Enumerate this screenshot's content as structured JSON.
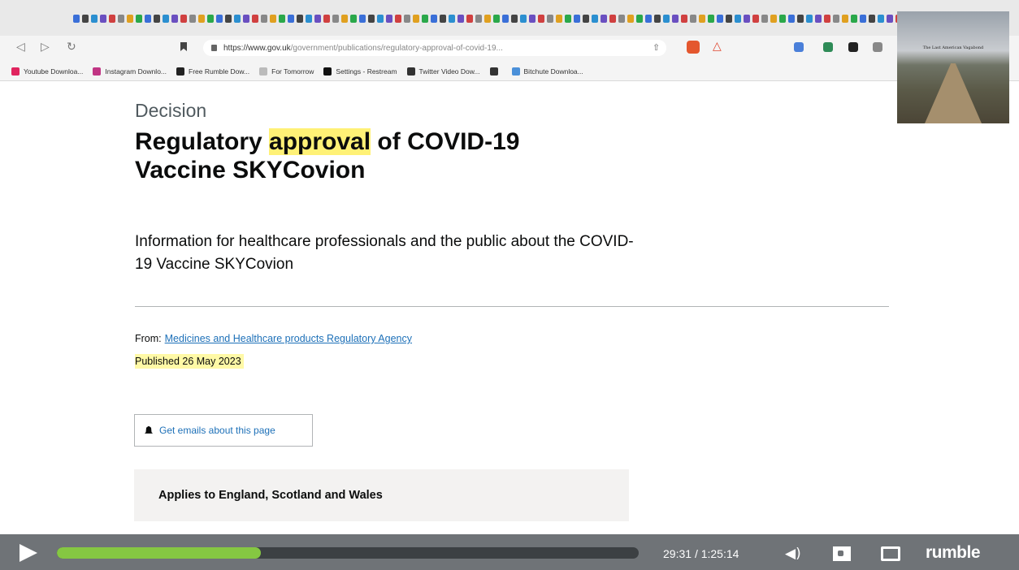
{
  "browser": {
    "url_host": "https://www.gov.uk",
    "url_path": "/government/publications/regulatory-approval-of-covid-19...",
    "bookmarks": [
      {
        "label": "Youtube Downloa...",
        "icon": "youtube-icon",
        "color": "#e0245e"
      },
      {
        "label": "Instagram Downlo...",
        "icon": "instagram-icon",
        "color": "#c13584"
      },
      {
        "label": "Free Rumble Dow...",
        "icon": "cloud-icon",
        "color": "#222222"
      },
      {
        "label": "For Tomorrow",
        "icon": "folder-icon",
        "color": "#bbbbbb"
      },
      {
        "label": "Settings - Restream",
        "icon": "restream-icon",
        "color": "#111111"
      },
      {
        "label": "Twitter Video Dow...",
        "icon": "globe-icon",
        "color": "#333333"
      },
      {
        "label": "",
        "icon": "globe-icon",
        "color": "#333333"
      },
      {
        "label": "Bitchute Downloa...",
        "icon": "bitchute-icon",
        "color": "#4a90d9"
      }
    ]
  },
  "overlay": {
    "caption": "The Last American Vagabond"
  },
  "page": {
    "kind": "Decision",
    "title_pre": "Regulatory ",
    "title_highlight": "approval",
    "title_post": " of COVID-19 Vaccine SKYCovion",
    "summary": "Information for healthcare professionals and the public about the COVID-19 Vaccine SKYCovion",
    "from_label": "From:",
    "from_org": "Medicines and Healthcare products Regulatory Agency",
    "published_label": "Published",
    "published_date": "26 May 2023",
    "email_button": "Get emails about this page",
    "applies_to": "Applies to England, Scotland and Wales"
  },
  "player": {
    "current_time": "29:31",
    "separator": "/",
    "duration": "1:25:14",
    "progress_fraction": 0.35,
    "brand": "rumble",
    "accent_color": "#85c742"
  }
}
